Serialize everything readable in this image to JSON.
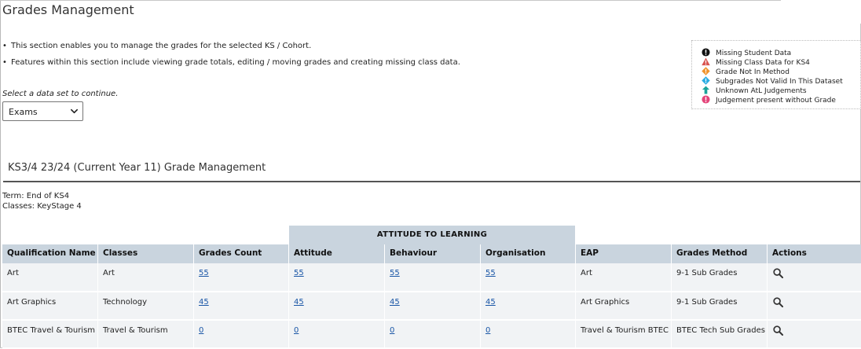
{
  "page": {
    "title": "Grades Management"
  },
  "intro": {
    "bullets": [
      "This section enables you to manage the grades for the selected KS / Cohort.",
      "Features within this section include viewing grade totals, editing / moving grades and creating missing class data."
    ]
  },
  "dataset": {
    "prompt": "Select a data set to continue.",
    "selected": "Exams"
  },
  "legend": {
    "items": [
      {
        "label": "Missing Student Data",
        "icon": "exclamation-circle-icon",
        "color": "#111111"
      },
      {
        "label": "Missing Class Data for KS4",
        "icon": "warning-triangle-icon",
        "color": "#d9534f"
      },
      {
        "label": "Grade Not In Method",
        "icon": "diamond-alert-icon",
        "color": "#f0932b"
      },
      {
        "label": "Subgrades Not Valid In This Dataset",
        "icon": "info-diamond-icon",
        "color": "#29abe2"
      },
      {
        "label": "Unknown AtL Judgements",
        "icon": "upload-arrow-icon",
        "color": "#1aa39a"
      },
      {
        "label": "Judgement present without Grade",
        "icon": "exclamation-circle-pink-icon",
        "color": "#e4457a"
      }
    ]
  },
  "section": {
    "title": "KS3/4 23/24 (Current Year 11) Grade Management",
    "term": "Term: End of KS4",
    "classes": "Classes: KeyStage 4"
  },
  "table": {
    "group_header": "ATTITUDE TO LEARNING",
    "columns": [
      "Qualification Name",
      "Classes",
      "Grades Count",
      "Attitude",
      "Behaviour",
      "Organisation",
      "EAP",
      "Grades Method",
      "Actions"
    ],
    "rows": [
      {
        "qualification": "Art",
        "classes": "Art",
        "grades_count": "55",
        "attitude": "55",
        "behaviour": "55",
        "organisation": "55",
        "eap": "Art",
        "method": "9-1 Sub Grades"
      },
      {
        "qualification": "Art Graphics",
        "classes": "Technology",
        "grades_count": "45",
        "attitude": "45",
        "behaviour": "45",
        "organisation": "45",
        "eap": "Art Graphics",
        "method": "9-1 Sub Grades"
      },
      {
        "qualification": "BTEC Travel & Tourism",
        "classes": "Travel & Tourism",
        "grades_count": "0",
        "attitude": "0",
        "behaviour": "0",
        "organisation": "0",
        "eap": "Travel & Tourism BTEC",
        "method": "BTEC Tech Sub Grades"
      }
    ]
  },
  "colors": {
    "header_bg": "#c9d4de",
    "row_bg": "#f1f3f5",
    "link": "#1a56a6"
  }
}
